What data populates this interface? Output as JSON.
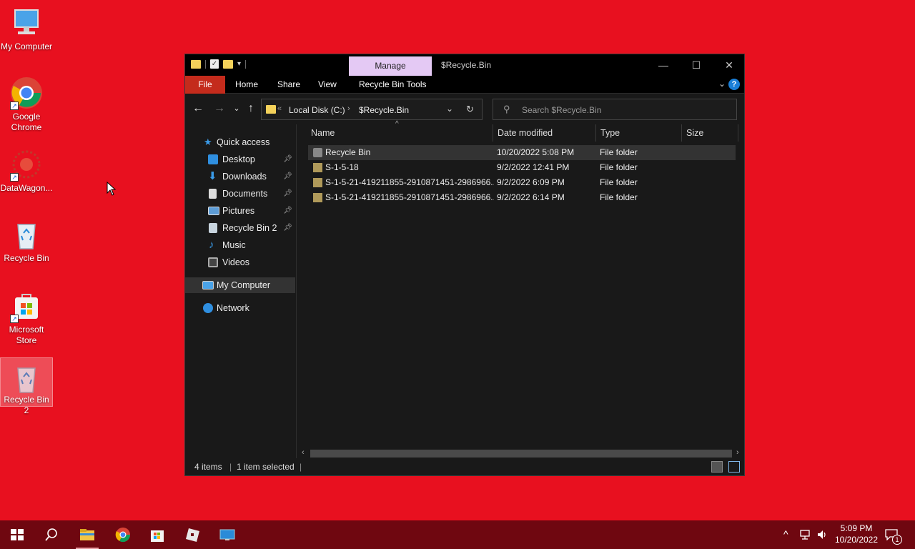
{
  "desktop": {
    "icons": [
      {
        "label": "My Computer",
        "icon": "computer-icon"
      },
      {
        "label": "Google Chrome",
        "icon": "chrome-icon"
      },
      {
        "label": "DataWagon...",
        "icon": "datawagon-icon"
      },
      {
        "label": "Recycle Bin",
        "icon": "recycle-bin-icon"
      },
      {
        "label": "Microsoft Store",
        "icon": "store-icon"
      },
      {
        "label": "Recycle Bin 2",
        "icon": "recycle-bin-icon"
      }
    ],
    "background_color": "#e8101f"
  },
  "window": {
    "title": "$Recycle.Bin",
    "manage_tab": "Manage",
    "ribbon_tabs": [
      "File",
      "Home",
      "Share",
      "View",
      "Recycle Bin Tools"
    ],
    "controls": {
      "minimize": "—",
      "maximize": "☐",
      "close": "✕"
    },
    "help": "?",
    "address": {
      "crumb1": "Local Disk (C:)",
      "crumb2": "$Recycle.Bin"
    },
    "search_placeholder": "Search $Recycle.Bin",
    "sidebar": {
      "quick_access": "Quick access",
      "items": [
        "Desktop",
        "Downloads",
        "Documents",
        "Pictures",
        "Recycle Bin 2",
        "Music",
        "Videos"
      ],
      "my_computer": "My Computer",
      "network": "Network"
    },
    "columns": {
      "name": "Name",
      "date": "Date modified",
      "type": "Type",
      "size": "Size"
    },
    "files": [
      {
        "name": "Recycle Bin",
        "date": "10/20/2022 5:08 PM",
        "type": "File folder"
      },
      {
        "name": "S-1-5-18",
        "date": "9/2/2022 12:41 PM",
        "type": "File folder"
      },
      {
        "name": "S-1-5-21-419211855-2910871451-2986966...",
        "date": "9/2/2022 6:09 PM",
        "type": "File folder"
      },
      {
        "name": "S-1-5-21-419211855-2910871451-2986966...",
        "date": "9/2/2022 6:14 PM",
        "type": "File folder"
      }
    ],
    "status": {
      "items": "4 items",
      "selected": "1 item selected"
    }
  },
  "taskbar": {
    "time": "5:09 PM",
    "date": "10/20/2022",
    "notification_count": "1"
  }
}
